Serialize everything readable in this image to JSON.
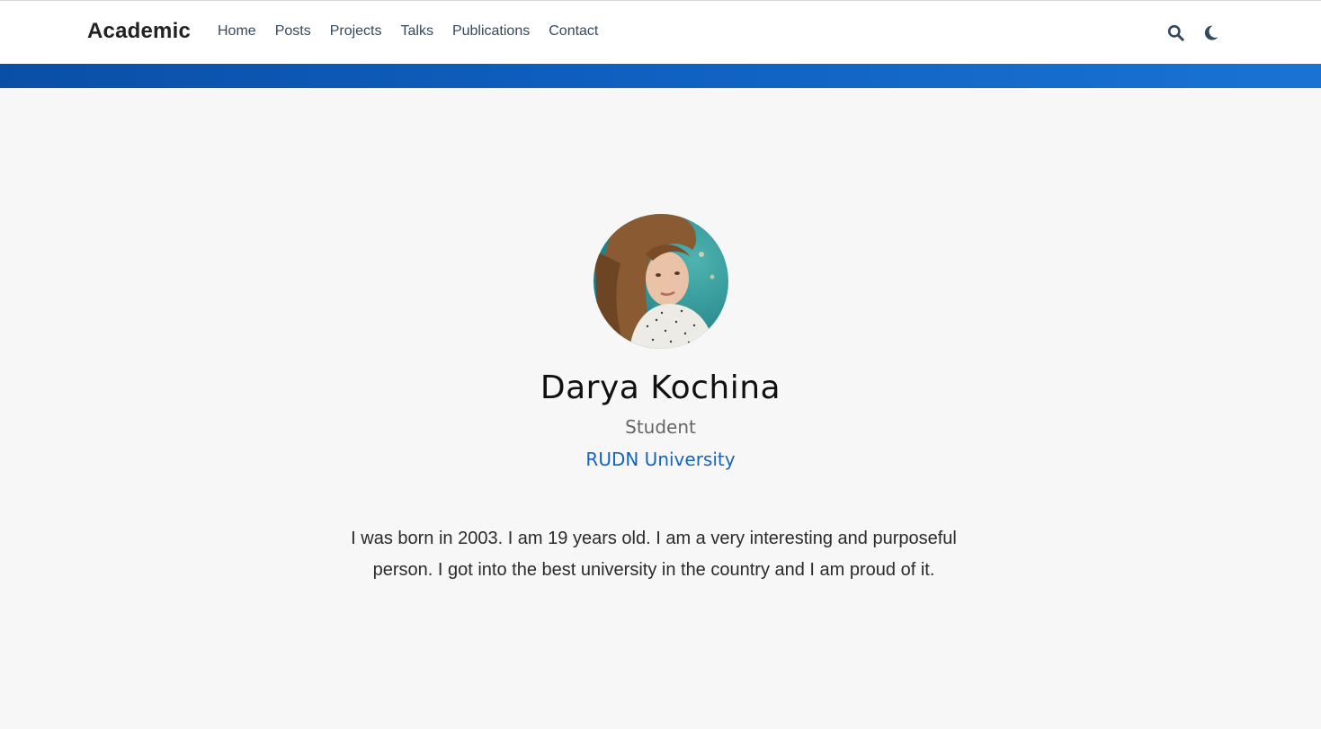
{
  "navbar": {
    "brand": "Academic",
    "links": [
      {
        "label": "Home"
      },
      {
        "label": "Posts"
      },
      {
        "label": "Projects"
      },
      {
        "label": "Talks"
      },
      {
        "label": "Publications"
      },
      {
        "label": "Contact"
      }
    ],
    "tools": {
      "search_icon": "search-icon",
      "theme_icon": "moon-icon"
    }
  },
  "colors": {
    "accent": "#1565c0",
    "band_start": "#0a4fa6",
    "band_end": "#1a73d3",
    "background": "#f7f7f7"
  },
  "profile": {
    "name": "Darya Kochina",
    "role": "Student",
    "organization": "RUDN University",
    "bio": "I was born in 2003. I am 19 years old. I am a very interesting and purposeful person. I got into the best university in the country and I am proud of it."
  }
}
